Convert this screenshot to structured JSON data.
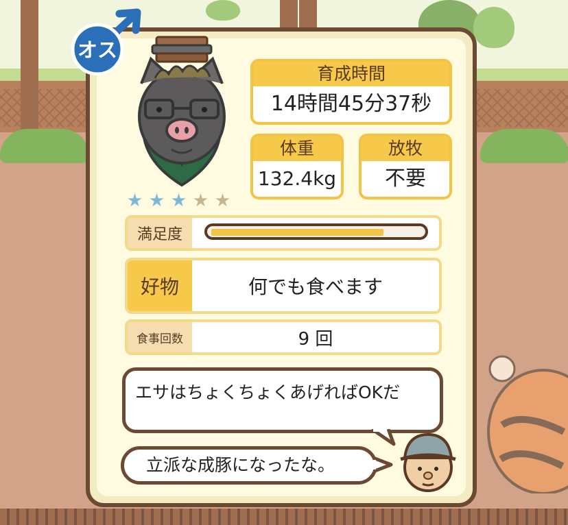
{
  "profile": {
    "gender_badge": "オス",
    "gender_icon": "male-symbol-icon",
    "rank_stars": {
      "filled": 3,
      "total": 5
    }
  },
  "stats": {
    "raising_time": {
      "label": "育成時間",
      "value": "14時間45分37秒"
    },
    "weight": {
      "label": "体重",
      "value": "132.4kg"
    },
    "grazing": {
      "label": "放牧",
      "value": "不要"
    }
  },
  "details": {
    "satisfaction": {
      "label": "満足度",
      "level": 0.82
    },
    "favorite_food": {
      "label": "好物",
      "value": "何でも食べます"
    },
    "meal_count": {
      "label": "食事回数",
      "value": "9 回"
    }
  },
  "dialog": {
    "hint": "エサはちょくちょくあげればOKだ",
    "comment": "立派な成豚になったな。"
  },
  "colors": {
    "gender_blue": "#2a6fb7",
    "header_yellow": "#f6c94a",
    "star_filled": "#7fb7d9",
    "star_empty": "#c9b48a",
    "card_border": "#6a4a33"
  }
}
